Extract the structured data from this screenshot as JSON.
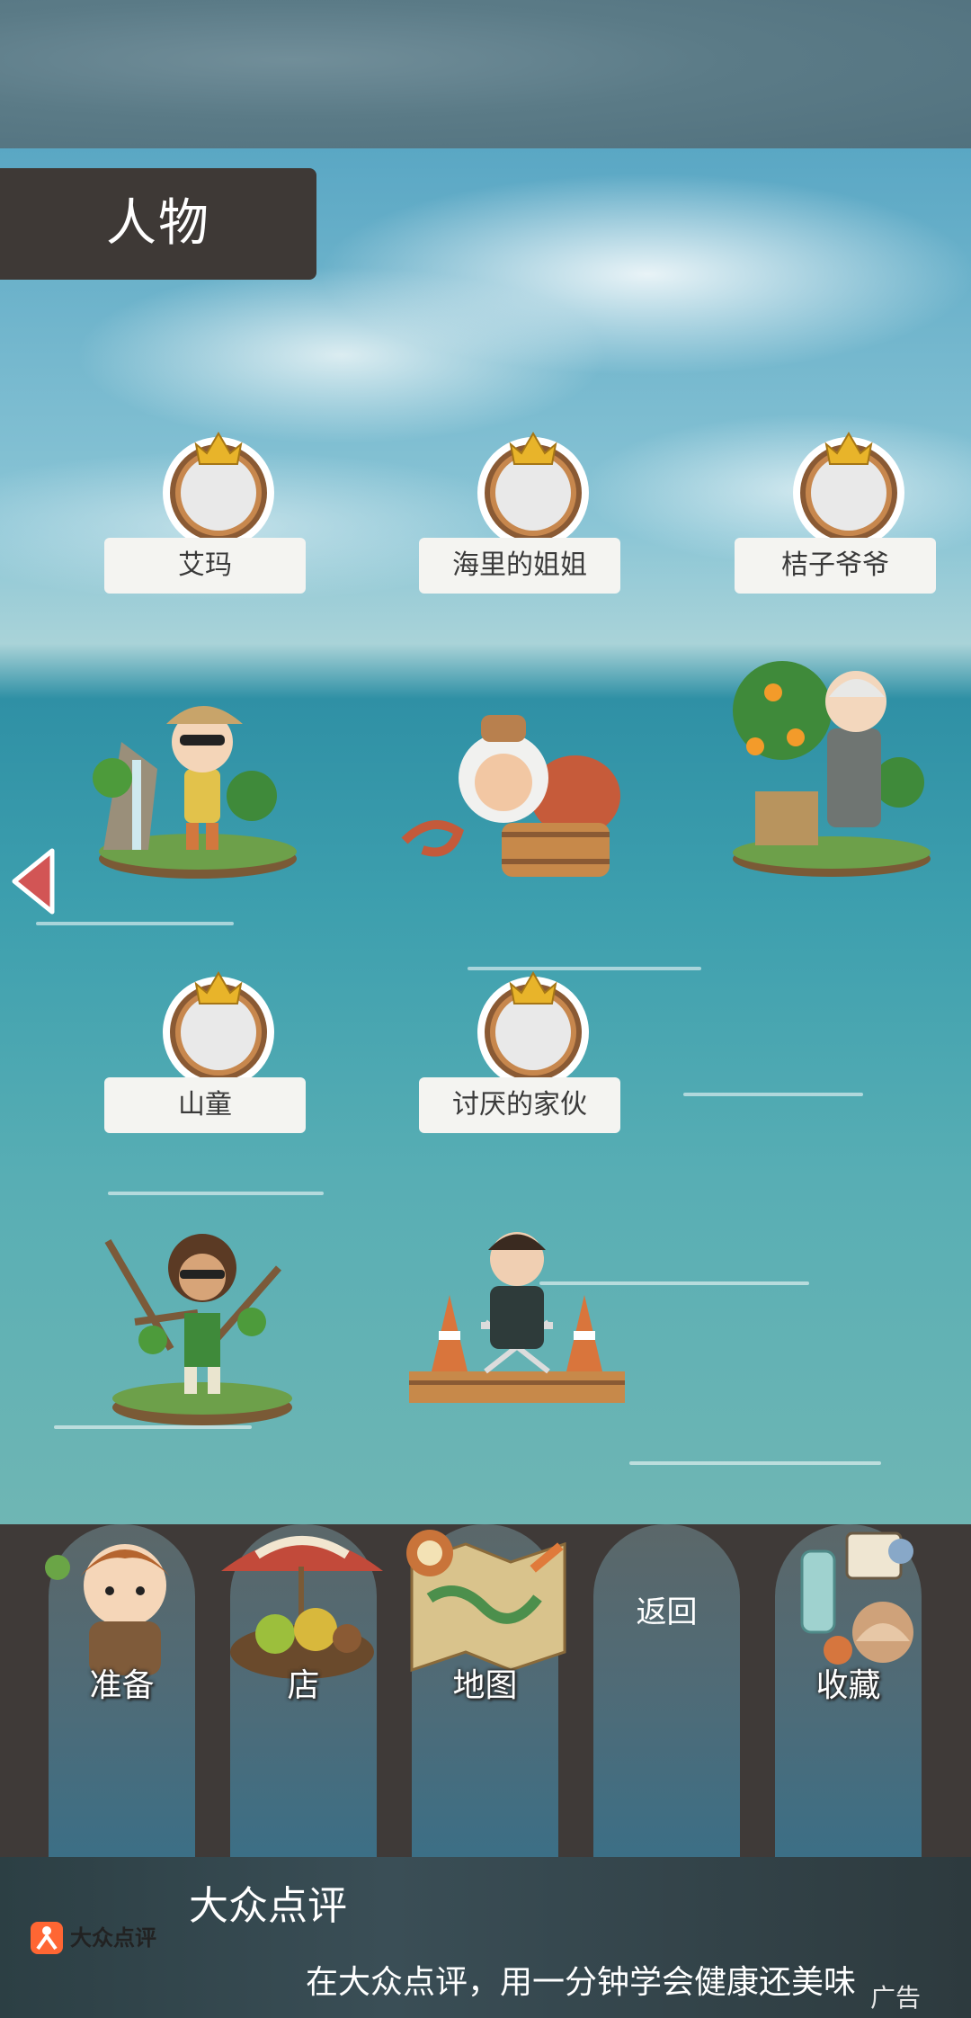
{
  "screen": {
    "title": "人物"
  },
  "characters": [
    {
      "name": "艾玛",
      "starred": true
    },
    {
      "name": "海里的姐姐",
      "starred": true
    },
    {
      "name": "桔子爷爷",
      "starred": true
    },
    {
      "name": "山童",
      "starred": true
    },
    {
      "name": "讨厌的家伙",
      "starred": true
    }
  ],
  "nav": {
    "back_icon": "left-triangle-icon"
  },
  "bottom_menu": {
    "prepare": "准备",
    "shop": "店",
    "map": "地图",
    "back": "返回",
    "collection": "收藏"
  },
  "ad": {
    "logo_text": "大众点评",
    "brand": "大众点评",
    "text": "在大众点评，用一分钟学会健康还美味",
    "tag": "广告"
  },
  "colors": {
    "accent": "#d25555",
    "plate": "#f4f4f1",
    "bar": "#3f3a38",
    "gold": "#e8b42a"
  }
}
